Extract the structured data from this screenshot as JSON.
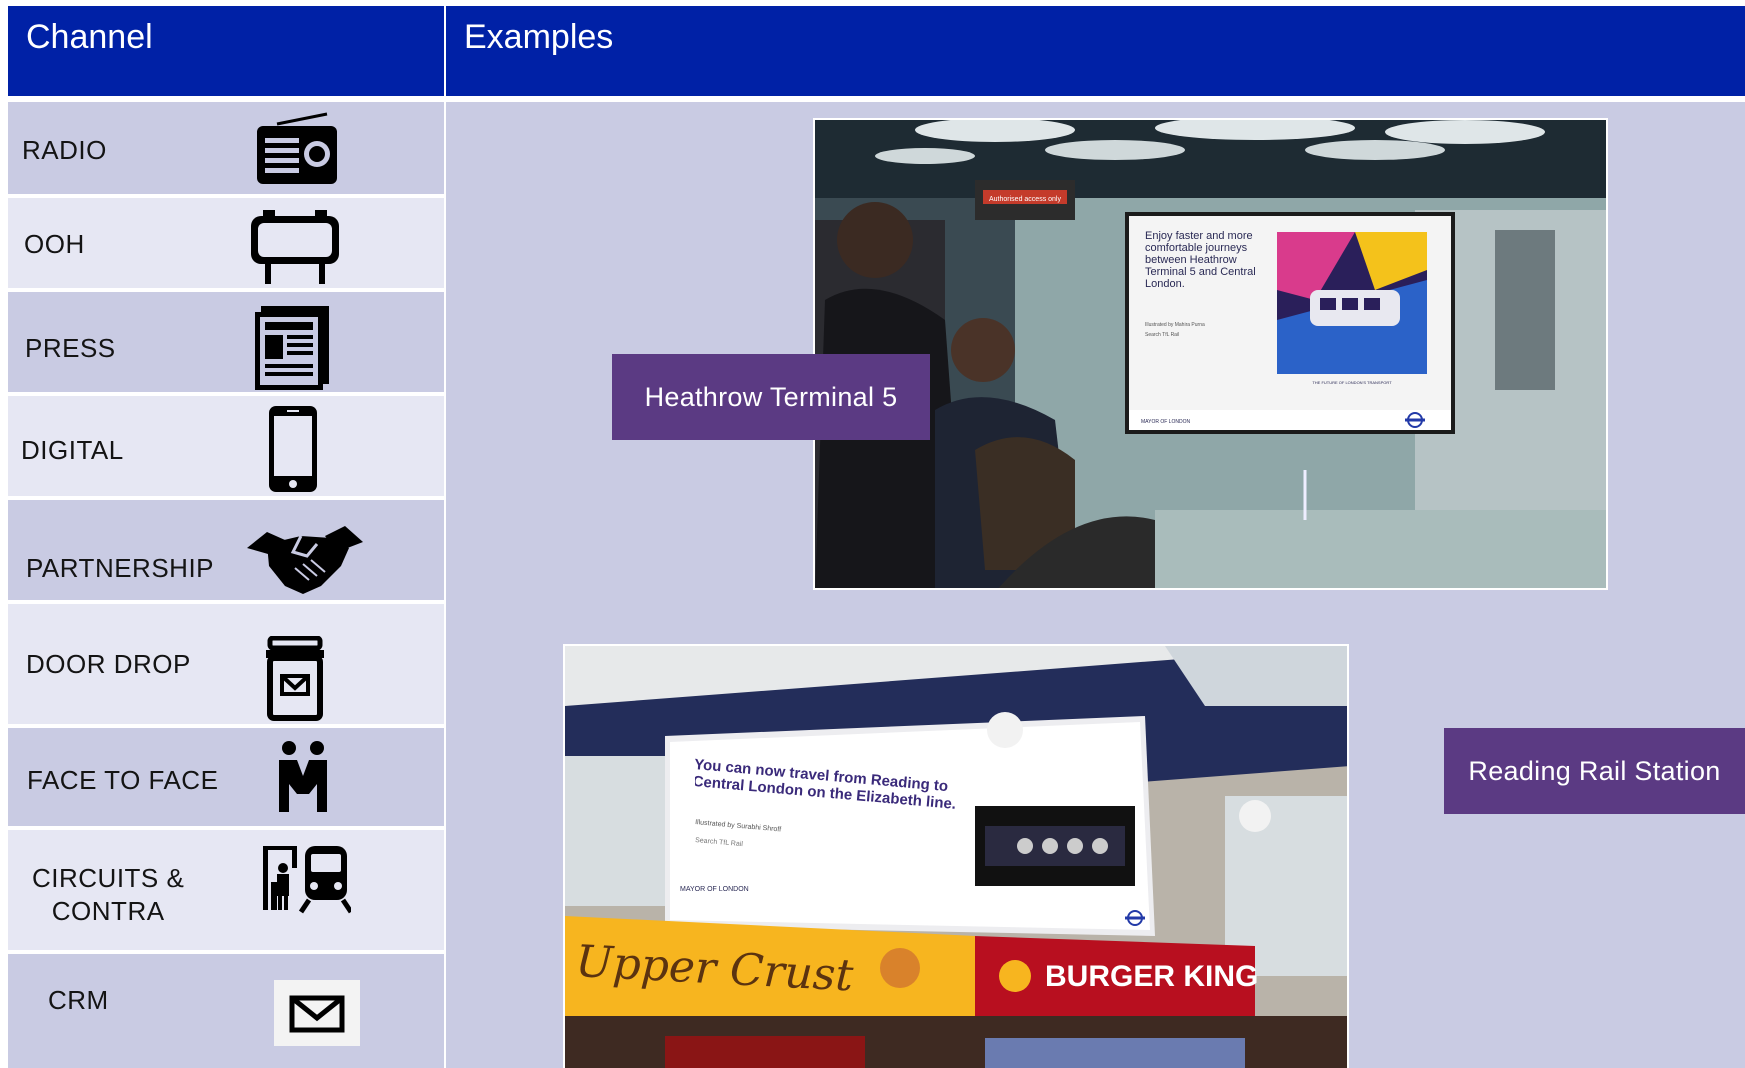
{
  "header": {
    "channel": "Channel",
    "examples": "Examples"
  },
  "channels": [
    {
      "label": "RADIO",
      "icon": "radio-icon"
    },
    {
      "label": "OOH",
      "icon": "billboard-icon"
    },
    {
      "label": "PRESS",
      "icon": "newspaper-icon"
    },
    {
      "label": "DIGITAL",
      "icon": "smartphone-icon"
    },
    {
      "label": "PARTNERSHIP",
      "icon": "handshake-icon"
    },
    {
      "label": "DOOR DROP",
      "icon": "mailbox-icon"
    },
    {
      "label": "FACE TO FACE",
      "icon": "people-icon"
    },
    {
      "label": "CIRCUITS &\nCONTRA",
      "icon": "train-station-icon"
    },
    {
      "label": "CRM",
      "icon": "envelope-icon"
    }
  ],
  "examples": [
    {
      "caption": "Heathrow Terminal 5",
      "poster_text": "Enjoy faster and more comfortable journeys between Heathrow Terminal 5 and Central London.",
      "poster_credit": "Illustrated by Mahira Purna",
      "poster_search": "Search TfL Rail",
      "poster_footer": "MAYOR OF LONDON",
      "poster_tagline": "THE FUTURE OF LONDON'S TRANSPORT",
      "sign_text": "Authorised access only"
    },
    {
      "caption": "Reading Rail Station",
      "poster_text": "You can now travel from Reading to Central London on the Elizabeth line.",
      "poster_credit": "Illustrated by Surabhi Shroff",
      "poster_search": "Search TfL Rail",
      "poster_footer": "MAYOR OF LONDON",
      "shop1": "Upper Crust",
      "shop2": "BURGER KING"
    }
  ],
  "colors": {
    "header": "#0021a6",
    "caption": "#5b3a83",
    "row_dark": "#c9cbe3",
    "row_light": "#e6e7f3"
  }
}
